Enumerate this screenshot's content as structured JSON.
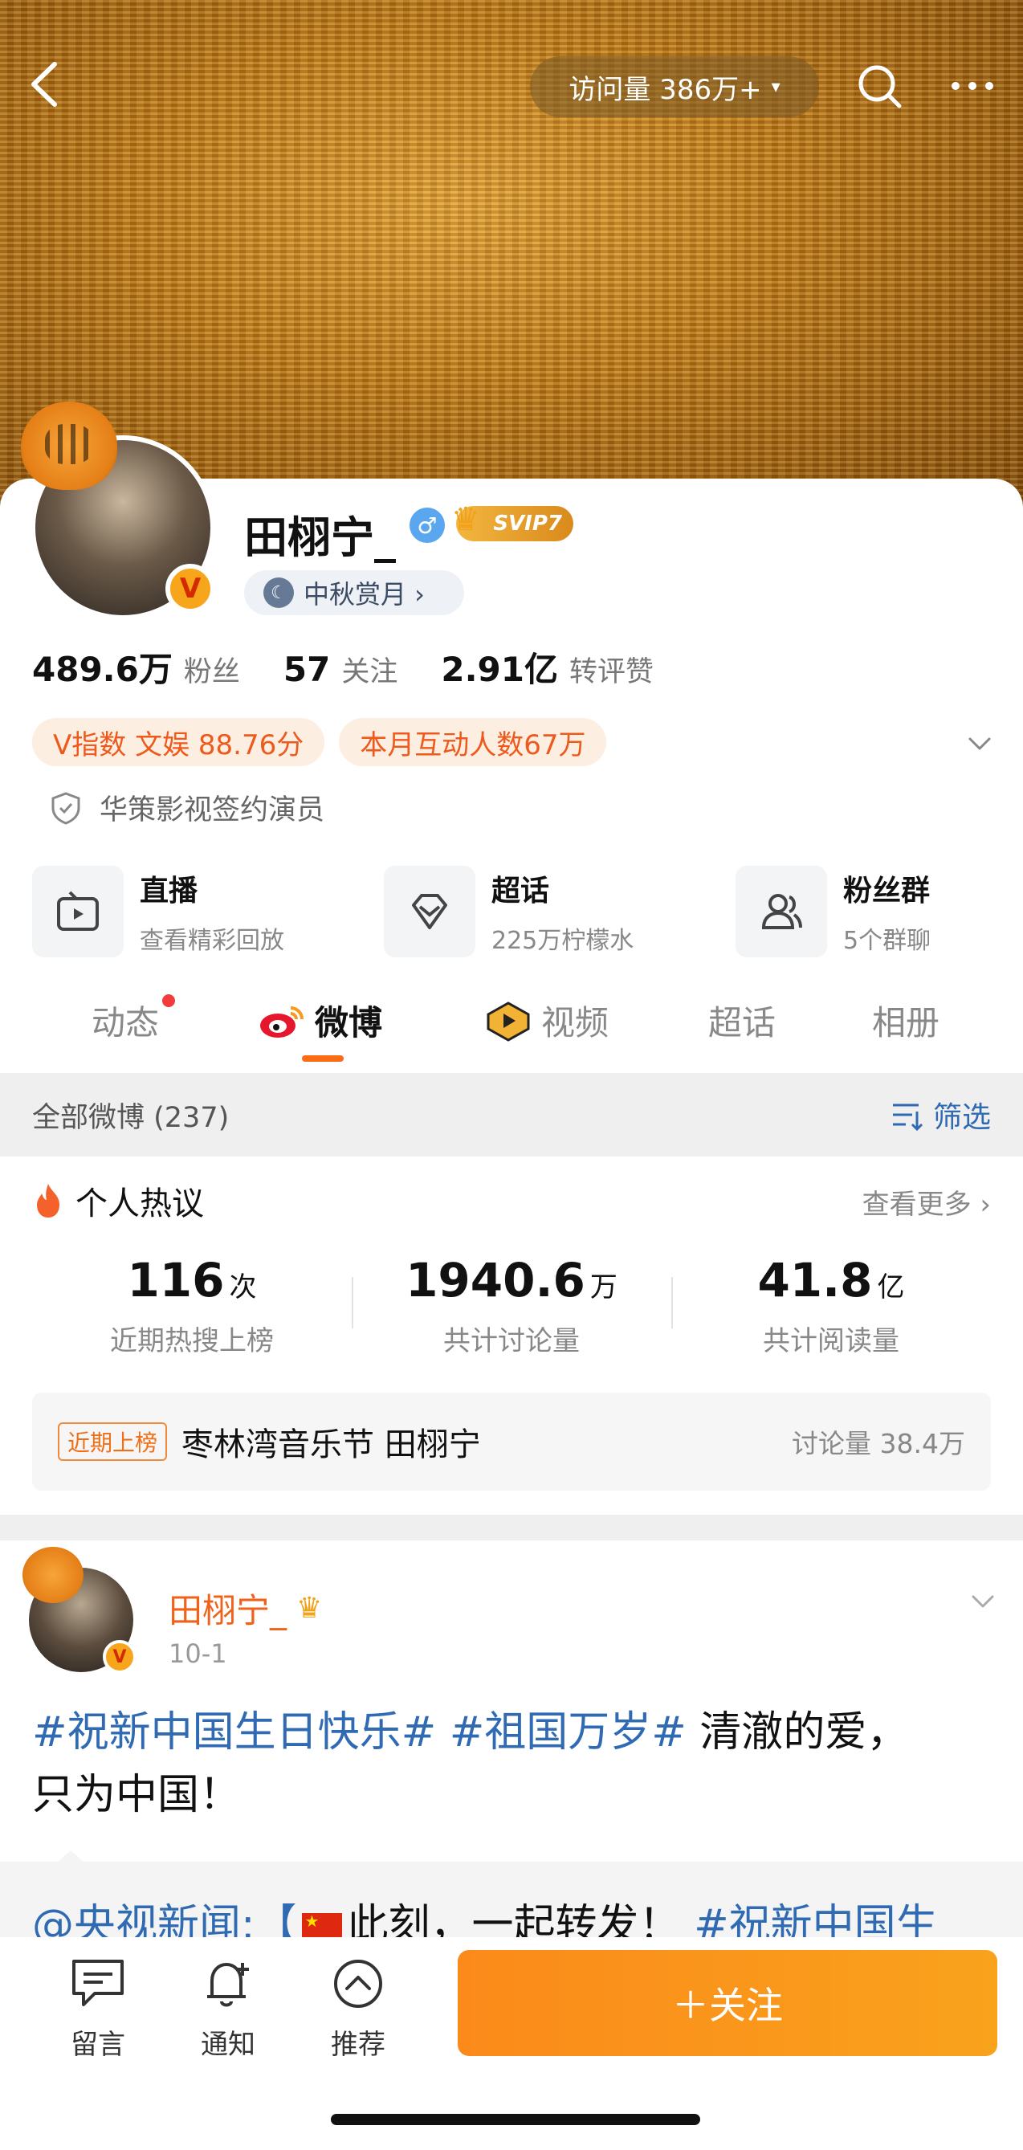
{
  "header": {
    "visits_label": "访问量 386万+",
    "visits_caret": "▾"
  },
  "profile": {
    "name": "田栩宁_",
    "gender_symbol": "♂",
    "vip_badge": "SVIP7",
    "verified_mark": "V",
    "moon_chip": "中秋赏月 ›",
    "stats": [
      {
        "value": "489.6万",
        "label": "粉丝"
      },
      {
        "value": "57",
        "label": "关注"
      },
      {
        "value": "2.91亿",
        "label": "转评赞"
      }
    ],
    "pills": [
      "V指数 文娱 88.76分",
      "本月互动人数67万"
    ],
    "certification": "华策影视签约演员"
  },
  "services": [
    {
      "title": "直播",
      "subtitle": "查看精彩回放",
      "icon": "tv-icon"
    },
    {
      "title": "超话",
      "subtitle": "225万柠檬水",
      "icon": "diamond-icon"
    },
    {
      "title": "粉丝群",
      "subtitle": "5个群聊",
      "icon": "group-icon"
    }
  ],
  "tabs": [
    "动态",
    "微博",
    "视频",
    "超话",
    "相册"
  ],
  "active_tab": "微博",
  "filter_bar": {
    "count_label": "全部微博 (237)",
    "filter_label": "筛选"
  },
  "hot": {
    "title": "个人热议",
    "more": "查看更多 ›",
    "stats": [
      {
        "value": "116",
        "unit": "次",
        "label": "近期热搜上榜"
      },
      {
        "value": "1940.6",
        "unit": "万",
        "label": "共计讨论量"
      },
      {
        "value": "41.8",
        "unit": "亿",
        "label": "共计阅读量"
      }
    ],
    "trend_tag": "近期上榜",
    "trend_text": "枣林湾音乐节 田栩宁",
    "trend_count": "讨论量 38.4万"
  },
  "post": {
    "author": "田栩宁_",
    "date": "10-1",
    "tag1": "#祝新中国生日快乐#",
    "tag2": "#祖国万岁#",
    "text_after": " 清澈的爱，",
    "line2": "只为中国！",
    "repost_mention": "@央视新闻:【",
    "repost_plain": "此刻，一起转发！",
    "repost_tag": "#祝新中国生"
  },
  "bottom_bar": {
    "comment": "留言",
    "notify": "通知",
    "recommend": "推荐",
    "follow": "＋关注"
  },
  "colors": {
    "accent_orange": "#f76c14",
    "link_blue": "#2f6ab3",
    "follow_button": "#fb8a1a"
  }
}
